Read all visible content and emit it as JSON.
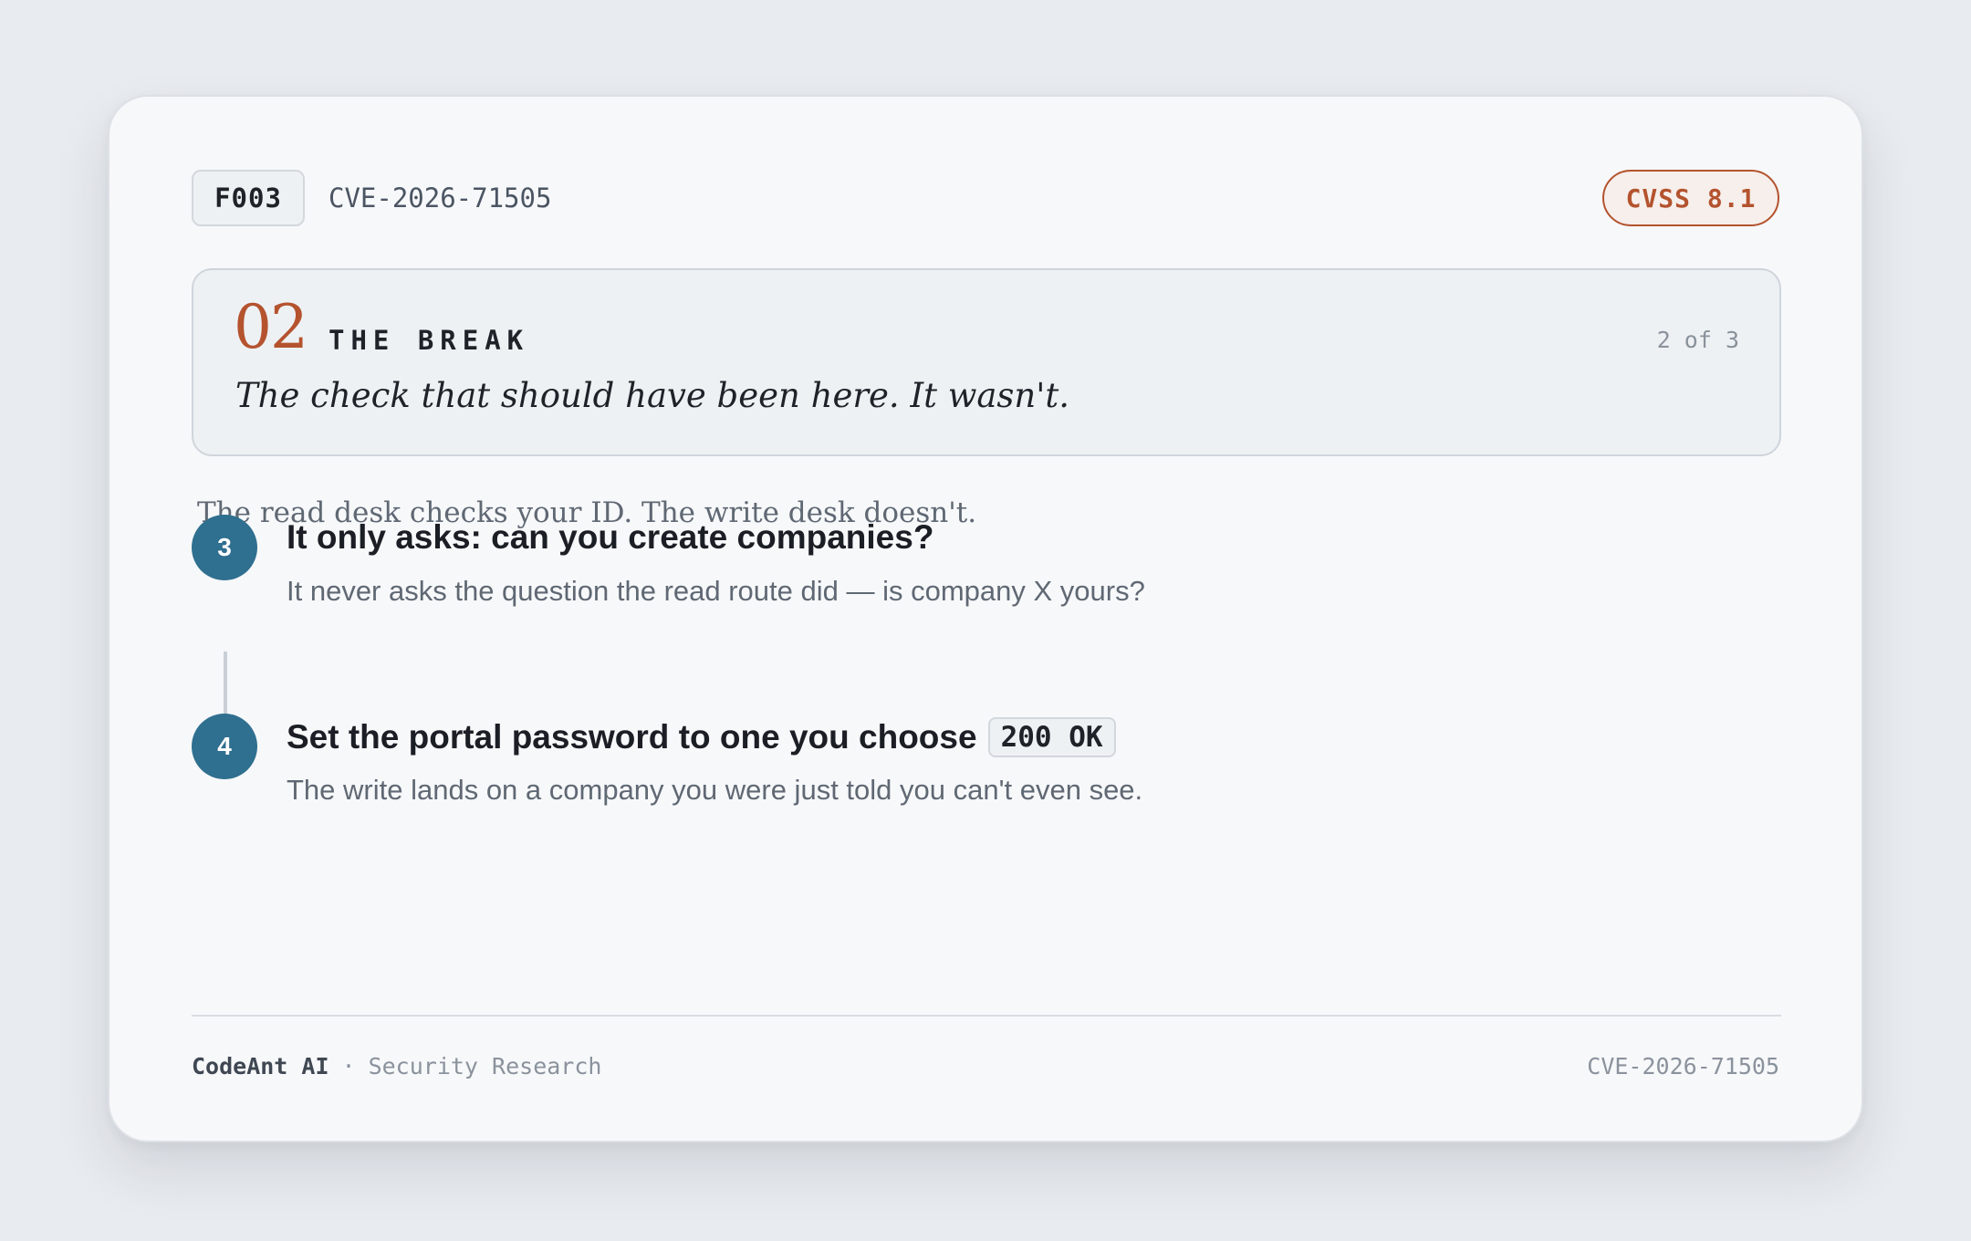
{
  "header": {
    "finding_id": "F003",
    "cve_id": "CVE-2026-71505",
    "cvss_label": "CVSS 8.1"
  },
  "section": {
    "number": "02",
    "title": "THE BREAK",
    "page_indicator": "2 of 3",
    "tagline": "The check that should have been here. It wasn't."
  },
  "lead": "The read desk checks your ID. The write desk doesn't.",
  "steps": [
    {
      "number": "3",
      "title": "It only asks: can you create companies?",
      "description": "It never asks the question the read route did — is company X yours?"
    },
    {
      "number": "4",
      "title": "Set the portal password to one you choose",
      "code": "200 OK",
      "description": "The write lands on a company you were just told you can't even see."
    }
  ],
  "footer": {
    "brand": "CodeAnt AI",
    "separator": "·",
    "subtitle": "Security Research",
    "cve_id": "CVE-2026-71505"
  },
  "colors": {
    "accent": "#b4532e",
    "step_badge": "#2f6f8f",
    "background": "#e8ebef",
    "card": "#f7f8fa"
  }
}
